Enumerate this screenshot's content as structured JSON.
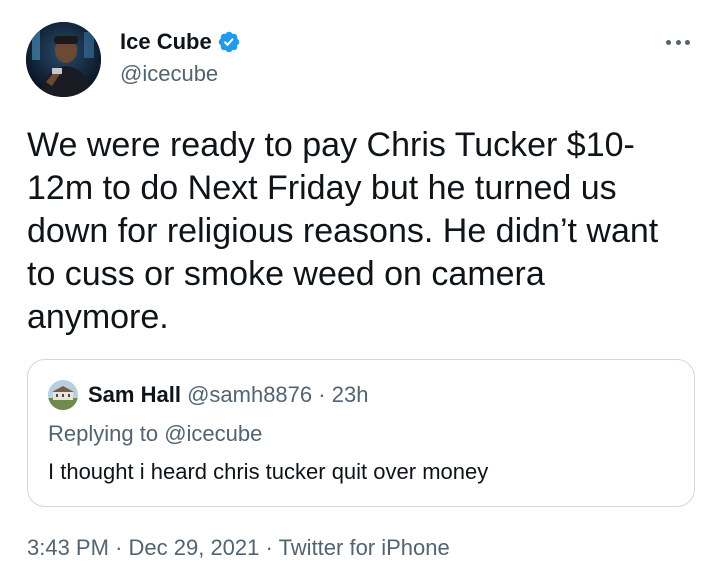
{
  "author": {
    "name": "Ice Cube",
    "handle": "@icecube",
    "verified": true,
    "avatar_icon": "profile-photo"
  },
  "more_icon": "more-dots-icon",
  "tweet": {
    "text": "We were ready to pay Chris Tucker $10-12m to do Next Friday but he turned us down for religious reasons. He didn’t want to cuss or smoke weed on camera anymore."
  },
  "quoted": {
    "name": "Sam Hall",
    "handle": "@samh8876",
    "separator": "·",
    "time": "23h",
    "replying_prefix": "Replying to ",
    "replying_to": "@icecube",
    "text": "I thought i heard chris tucker quit over money"
  },
  "footer": {
    "time": "3:43 PM",
    "separator": "·",
    "date": "Dec 29, 2021",
    "source": "Twitter for iPhone"
  },
  "colors": {
    "text": "#0f1419",
    "secondary": "#536471",
    "verified": "#1d9bf0",
    "border": "#cfd9de"
  }
}
